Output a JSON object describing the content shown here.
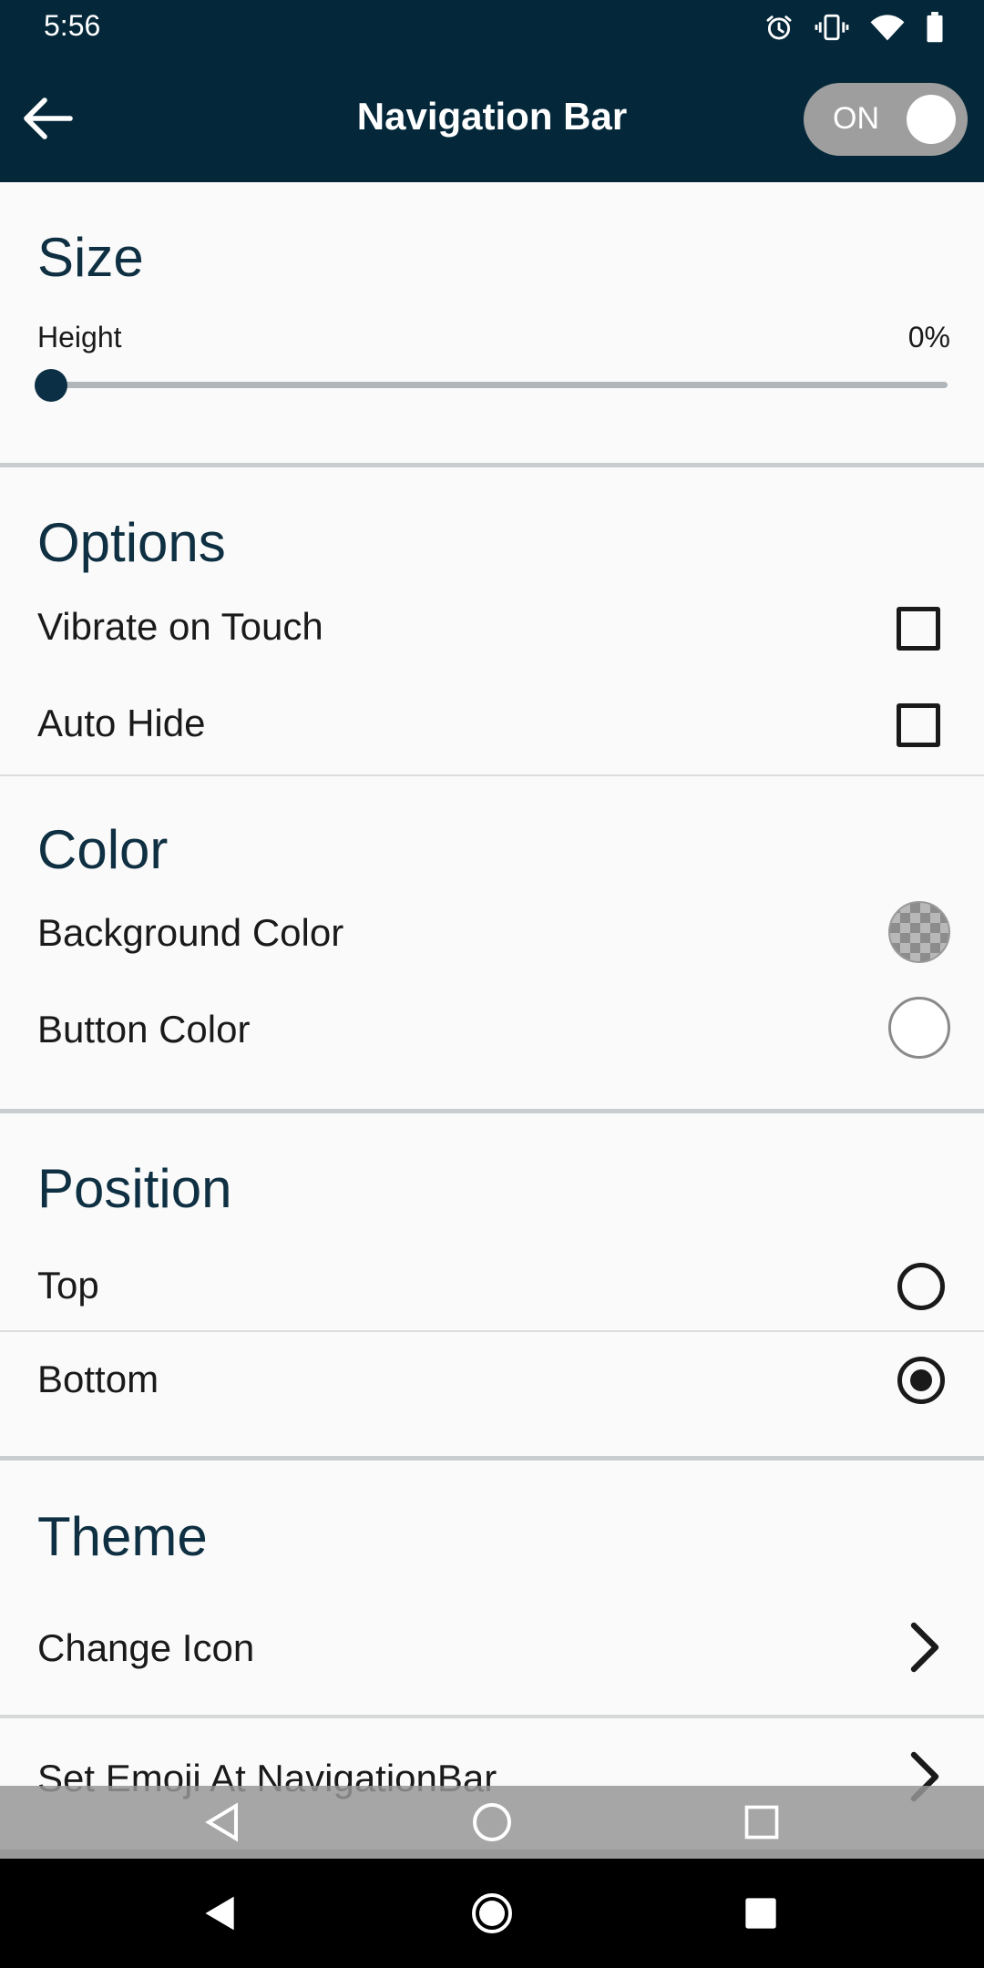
{
  "status_bar": {
    "time": "5:56",
    "icons": [
      "alarm-icon",
      "vibrate-icon",
      "wifi-icon",
      "battery-icon"
    ]
  },
  "app_bar": {
    "title": "Navigation Bar",
    "back_icon": "arrow-left-icon",
    "toggle_label": "ON",
    "toggle_on": true
  },
  "size": {
    "title": "Size",
    "height_label": "Height",
    "height_value": "0%",
    "slider_fraction": 0
  },
  "options": {
    "title": "Options",
    "vibrate_label": "Vibrate on Touch",
    "vibrate_checked": false,
    "auto_hide_label": "Auto Hide",
    "auto_hide_checked": false
  },
  "color": {
    "title": "Color",
    "background_label": "Background Color",
    "background_value": "transparent",
    "button_label": "Button Color",
    "button_value": "#ffffff"
  },
  "position": {
    "title": "Position",
    "top_label": "Top",
    "bottom_label": "Bottom",
    "selected": "Bottom"
  },
  "theme": {
    "title": "Theme",
    "change_icon_label": "Change Icon",
    "set_emoji_label": "Set Emoji At NavigationBar"
  },
  "colors": {
    "primary_dark": "#04283a",
    "section_title": "#0f3042",
    "toggle_track": "#9e9e9e"
  }
}
